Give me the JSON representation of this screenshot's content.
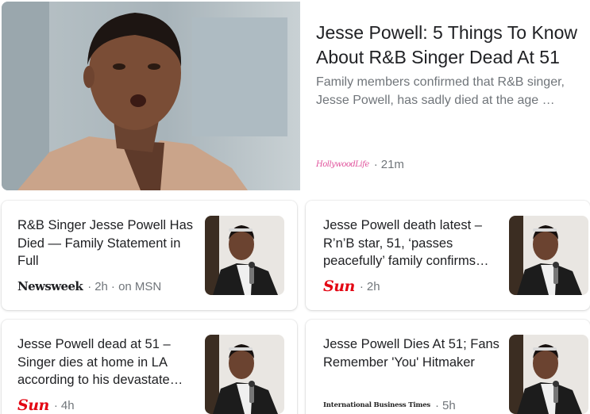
{
  "hero": {
    "title": "Jesse Powell: 5 Things To Know About R&B Singer Dead At 51",
    "snippet": "Family members confirmed that R&B singer, Jesse Powell, has sadly died at the age …",
    "source_logo_text": "HollywoodLife",
    "sep": "·",
    "time": "21m"
  },
  "cards": [
    {
      "title": "R&B Singer Jesse Powell Has Died — Family Statement in Full",
      "source_logo_text": "Newsweek",
      "sep": "·",
      "time": "2h",
      "extra": "· on MSN"
    },
    {
      "title": "Jesse Powell death latest – R’n’B star, 51, ‘passes peacefully’ family confirms…",
      "source_logo_text": "The Sun",
      "sep": "·",
      "time": "2h"
    },
    {
      "title": "Jesse Powell dead at 51 – Singer dies at home in LA according to his devastate…",
      "source_logo_text": "The Sun",
      "sep": "·",
      "time": "4h"
    },
    {
      "title": "Jesse Powell Dies At 51; Fans Remember 'You' Hitmaker",
      "source_logo_text": "International Business Times",
      "sep": "·",
      "time": "5h"
    }
  ],
  "colors": {
    "title": "#202124",
    "meta": "#70757a",
    "sun_red": "#e30613",
    "hollywoodlife_pink": "#e0529c"
  }
}
